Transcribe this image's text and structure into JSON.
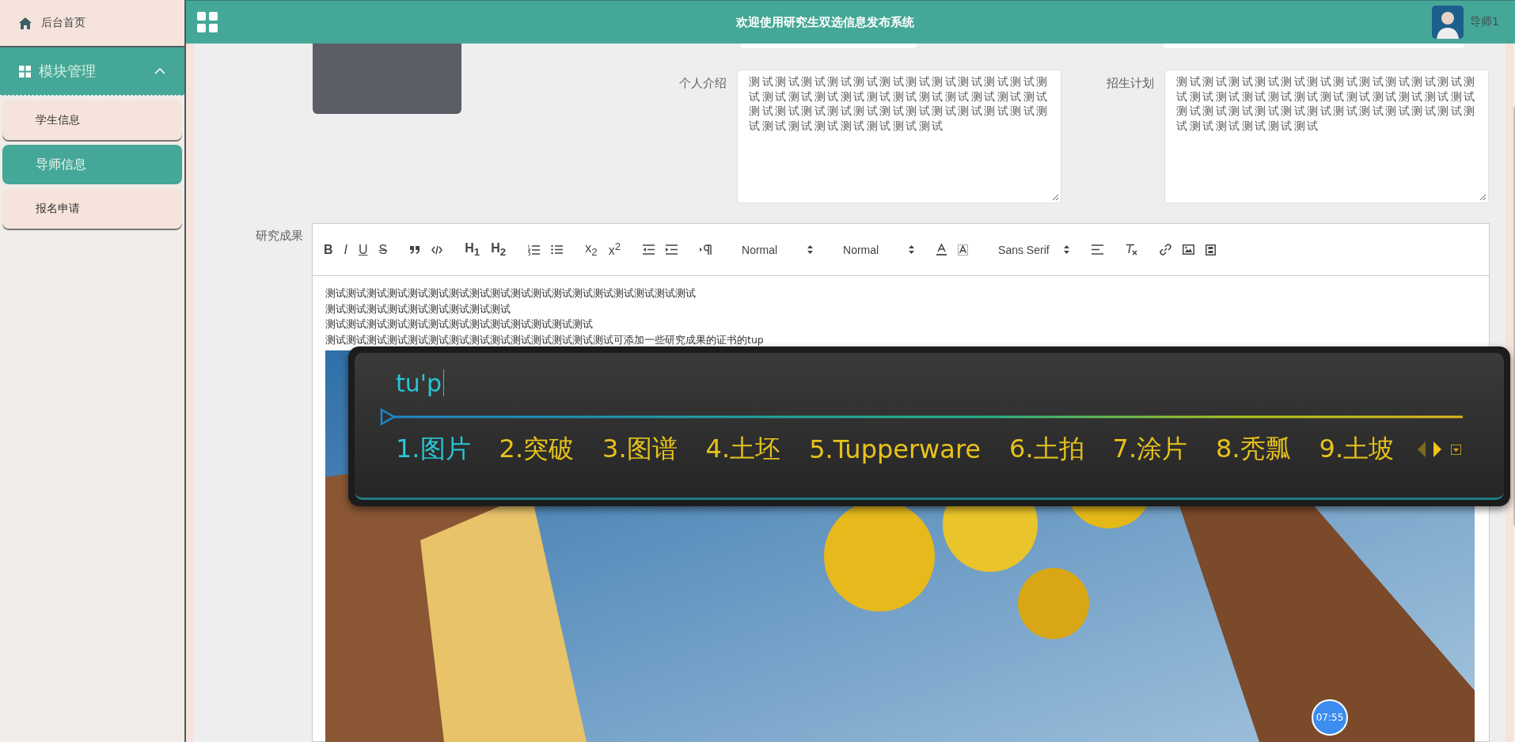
{
  "sidebar": {
    "home": {
      "label": "后台首页"
    },
    "group": {
      "label": "模块管理",
      "expanded": true,
      "items": [
        {
          "label": "学生信息",
          "selected": false
        },
        {
          "label": "导师信息",
          "selected": true
        },
        {
          "label": "报名申请",
          "selected": false
        }
      ]
    }
  },
  "header": {
    "title": "欢迎使用研究生双选信息发布系统",
    "user": "导师1"
  },
  "form": {
    "fields": [
      {
        "label": "个人介绍",
        "value": "测试测试测试测试测试测试测试测试测试测试测试测试测试测试测试测试测试测试测试测试测试测试测试测试测试测试测试测试测试测试测试测试测试测试测试测试测试测试测试测试测试测试"
      },
      {
        "label": "招生计划",
        "value": "测试测试测试测试测试测试测试测试测试测试测试测试测试测试测试测试测试测试测试测试测试测试测试测试测试测试测试测试测试测试测试测试测试测试测试测试测试测试测试测试"
      }
    ],
    "research": {
      "label": "研究成果",
      "toolbar": [
        [
          {
            "kind": "bold",
            "label": "B"
          },
          {
            "kind": "italic",
            "label": "I"
          },
          {
            "kind": "underline",
            "label": "U"
          },
          {
            "kind": "strike",
            "label": "S"
          }
        ],
        [
          {
            "kind": "quote"
          },
          {
            "kind": "code"
          }
        ],
        [
          {
            "kind": "header",
            "label": "H$_{1}$"
          },
          {
            "kind": "header",
            "label": "H$_{2}$"
          }
        ],
        [
          {
            "kind": "ordered-list"
          },
          {
            "kind": "bullet-list"
          }
        ],
        [
          {
            "kind": "script",
            "label": "x$_{2}$"
          },
          {
            "kind": "script",
            "label": "x$^{2}$"
          }
        ],
        [
          {
            "kind": "outdent"
          },
          {
            "kind": "indent"
          }
        ],
        [
          {
            "kind": "direction"
          }
        ],
        [
          {
            "kind": "select",
            "label": "Normal"
          }
        ],
        [
          {
            "kind": "select",
            "label": "Normal"
          }
        ],
        [
          {
            "kind": "color"
          },
          {
            "kind": "background"
          }
        ],
        [
          {
            "kind": "select",
            "label": "Sans Serif"
          }
        ],
        [
          {
            "kind": "align"
          }
        ],
        [
          {
            "kind": "clean"
          }
        ],
        [
          {
            "kind": "link"
          },
          {
            "kind": "image"
          },
          {
            "kind": "video"
          }
        ]
      ],
      "lines": [
        "测试测试测试测试测试测试测试测试测试测试测试测试测试测试测试测试测试测试",
        "测试测试测试测试测试测试测试测试测试",
        "测试测试测试测试测试测试测试测试测试测试测试测试测试",
        "测试测试测试测试测试测试测试测试测试测试测试测试测试测试可添加一些研究成果的证书的tup"
      ]
    }
  },
  "ime": {
    "composition": "tu'p",
    "candidates": [
      {
        "label": "1.图片",
        "selected": true
      },
      {
        "label": "2.突破",
        "selected": false
      },
      {
        "label": "3.图谱",
        "selected": false
      },
      {
        "label": "4.土坯",
        "selected": false
      },
      {
        "label": "5.Tupperware",
        "selected": false
      },
      {
        "label": "6.土拍",
        "selected": false
      },
      {
        "label": "7.涂片",
        "selected": false
      },
      {
        "label": "8.秃瓢",
        "selected": false
      },
      {
        "label": "9.土坡",
        "selected": false
      }
    ]
  },
  "timer": "07:55"
}
